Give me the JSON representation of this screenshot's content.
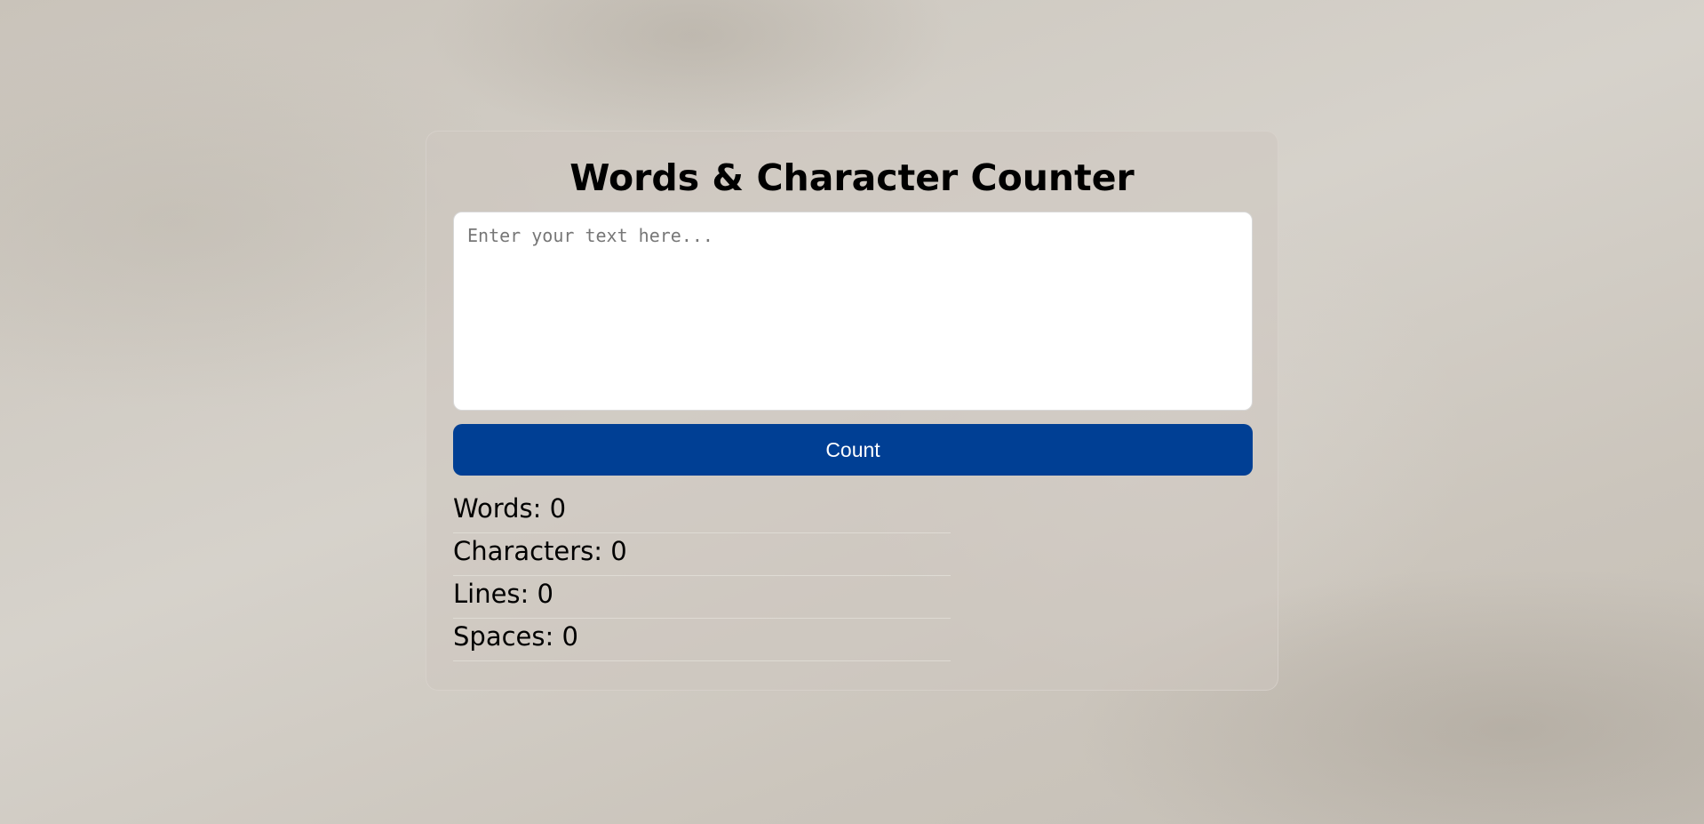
{
  "app": {
    "title": "Words & Character Counter"
  },
  "editor": {
    "placeholder": "Enter your text here...",
    "value": ""
  },
  "actions": {
    "count_label": "Count"
  },
  "stats": {
    "words": "Words: 0",
    "characters": "Characters: 0",
    "lines": "Lines: 0",
    "spaces": "Spaces: 0"
  },
  "colors": {
    "button": "#003f94",
    "button_text": "#ffffff",
    "textarea_bg": "#ffffff"
  }
}
